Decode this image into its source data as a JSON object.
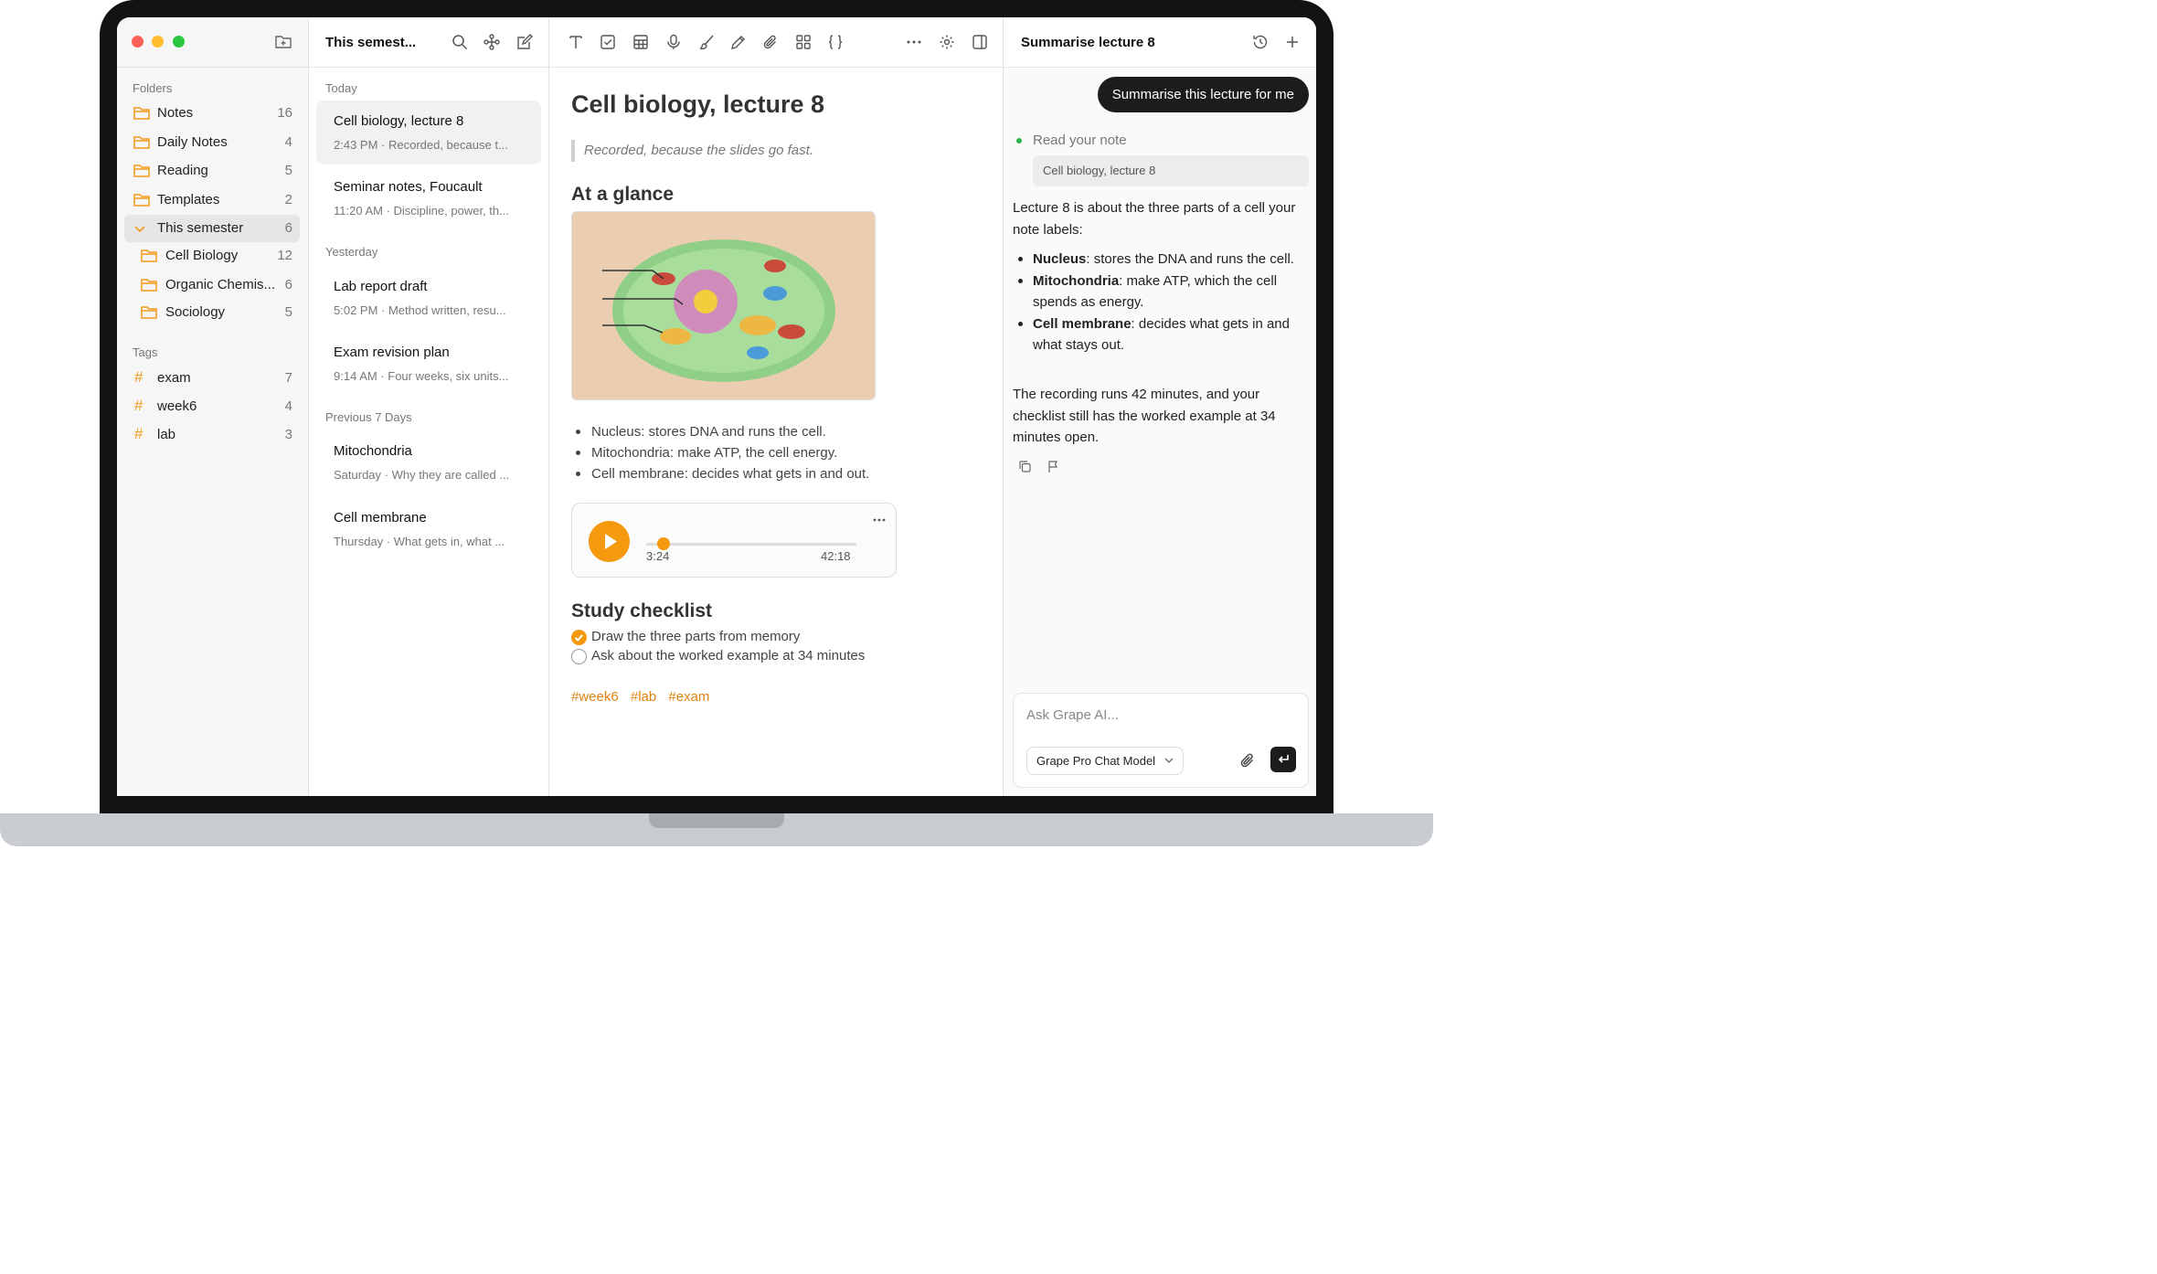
{
  "sidebar": {
    "folders_label": "Folders",
    "folders": [
      {
        "label": "Notes",
        "count": "16"
      },
      {
        "label": "Daily Notes",
        "count": "4"
      },
      {
        "label": "Reading",
        "count": "5"
      },
      {
        "label": "Templates",
        "count": "2"
      },
      {
        "label": "This semester",
        "count": "6"
      },
      {
        "label": "Cell Biology",
        "count": "12"
      },
      {
        "label": "Organic Chemis...",
        "count": "6"
      },
      {
        "label": "Sociology",
        "count": "5"
      }
    ],
    "tags_label": "Tags",
    "tags": [
      {
        "label": "exam",
        "count": "7"
      },
      {
        "label": "week6",
        "count": "4"
      },
      {
        "label": "lab",
        "count": "3"
      }
    ]
  },
  "notelist": {
    "title": "This semest...",
    "groups": [
      "Today",
      "Yesterday",
      "Previous 7 Days"
    ],
    "notes": [
      {
        "title": "Cell biology, lecture 8",
        "meta": "2:43 PM · Recorded, because t..."
      },
      {
        "title": "Seminar notes, Foucault",
        "meta": "11:20 AM · Discipline, power, th..."
      },
      {
        "title": "Lab report draft",
        "meta": "5:02 PM · Method written, resu..."
      },
      {
        "title": "Exam revision plan",
        "meta": "9:14 AM · Four weeks, six units..."
      },
      {
        "title": "Mitochondria",
        "meta": "Saturday · Why they are called ..."
      },
      {
        "title": "Cell membrane",
        "meta": "Thursday · What gets in, what ..."
      }
    ]
  },
  "editor": {
    "title": "Cell biology, lecture 8",
    "quote": "Recorded, because the slides go fast.",
    "glance_heading": "At a glance",
    "bullets": [
      "Nucleus: stores DNA and runs the cell.",
      "Mitochondria: make ATP, the cell energy.",
      "Cell membrane: decides what gets in and out."
    ],
    "audio": {
      "elapsed": "3:24",
      "total": "42:18",
      "progress": 0.081
    },
    "checklist_heading": "Study checklist",
    "checklist": [
      {
        "text": "Draw the three parts from memory",
        "done": true
      },
      {
        "text": "Ask about the worked example at 34 minutes",
        "done": false
      }
    ],
    "tags": [
      "#week6",
      "#lab",
      "#exam"
    ]
  },
  "chat": {
    "title": "Summarise lecture 8",
    "user_message": "Summarise this lecture for me",
    "tool_status": "Read your note",
    "tool_ref": "Cell biology, lecture 8",
    "intro": "Lecture 8 is about the three parts of a cell your note labels:",
    "points": [
      {
        "term": "Nucleus",
        "text": ": stores the DNA and runs the cell."
      },
      {
        "term": "Mitochondria",
        "text": ": make ATP, which the cell spends as energy."
      },
      {
        "term": "Cell membrane",
        "text": ": decides what gets in and what stays out."
      }
    ],
    "outro": "The recording runs 42 minutes, and your checklist still has the worked example at 34 minutes open.",
    "input_placeholder": "Ask Grape AI...",
    "model": "Grape Pro Chat Model"
  },
  "colors": {
    "accent": "#f5990f",
    "tag": "#e0820e",
    "folder": "#f29a1a"
  }
}
